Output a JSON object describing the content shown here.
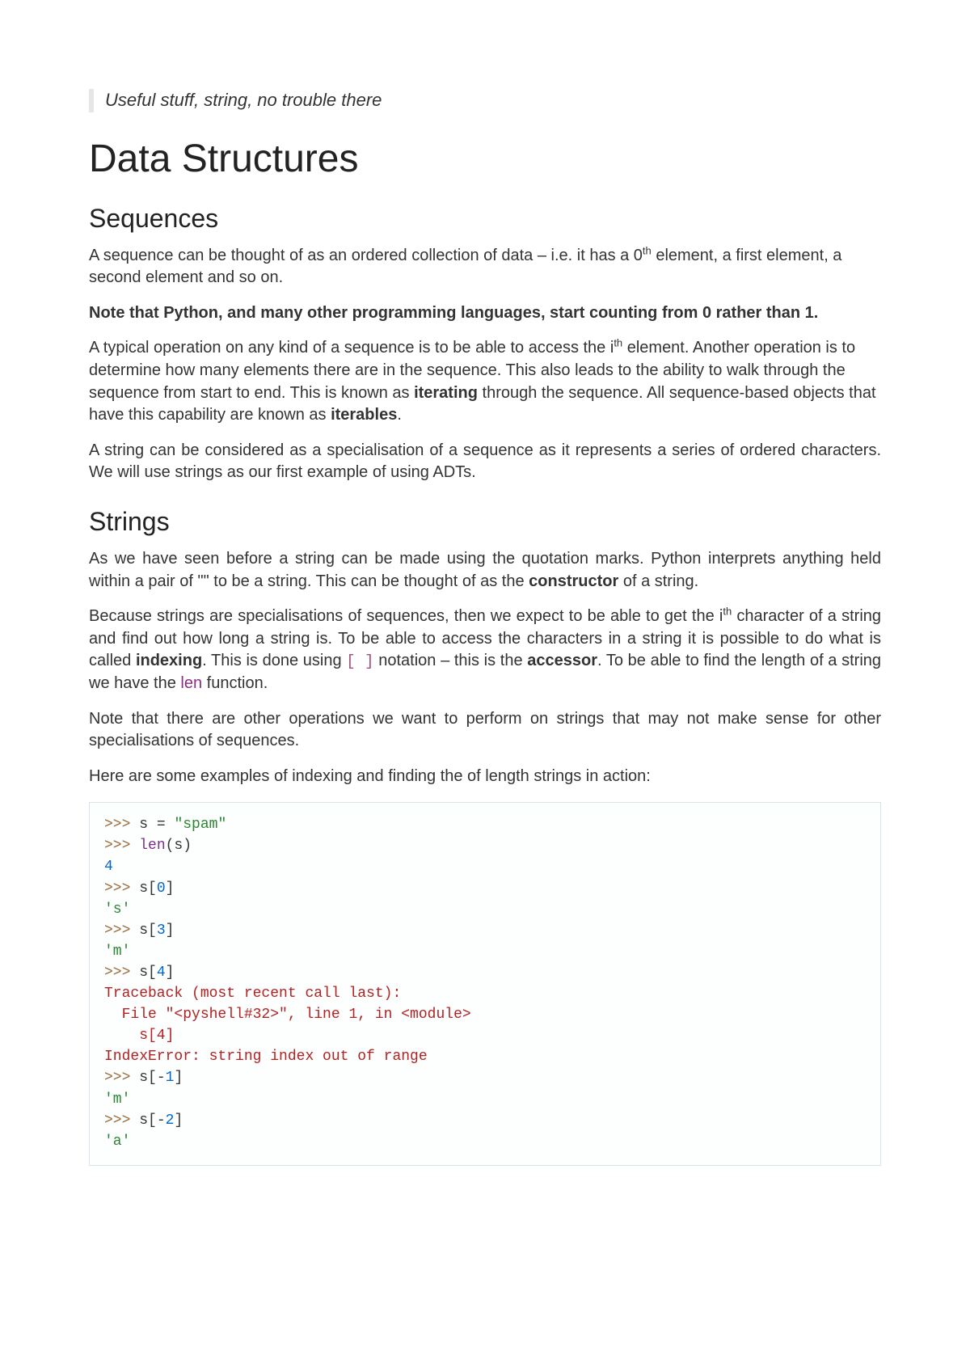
{
  "quote": "Useful stuff, string, no trouble there",
  "title": "Data Structures",
  "sequences": {
    "heading": "Sequences",
    "p1_a": "A sequence can be thought of as an ordered collection of data – i.e. it has a 0",
    "p1_sup": "th",
    "p1_b": " element, a first element, a second element and so on.",
    "note": "Note that Python, and many other programming languages, start counting from 0 rather than 1.",
    "p2_a": "A typical operation on any kind of a sequence is to be able to access the i",
    "p2_sup": "th",
    "p2_b": " element. Another operation is to determine how many elements there are in the sequence. This also leads to the ability to walk through the sequence from start to end. This is known as ",
    "p2_bold1": "iterating",
    "p2_c": " through the sequence. All sequence-based objects that have this capability are known as ",
    "p2_bold2": "iterables",
    "p2_d": ".",
    "p3": "A string can be considered as a specialisation of a sequence as it represents a series of ordered characters. We will use strings as our first example of using ADTs."
  },
  "strings": {
    "heading": "Strings",
    "p1_a": "As we have seen before a string can be made using the quotation marks. Python interprets anything held within a pair of \"\" to be a string. This can be thought of as the ",
    "p1_bold": "constructor",
    "p1_b": " of a string.",
    "p2_a": "Because strings are specialisations of sequences, then we expect to be able to get the i",
    "p2_sup": "th",
    "p2_b": " character of a string and find out how long a string is. To be able to access the characters in a string it is possible to do what is called ",
    "p2_bold1": "indexing",
    "p2_c": ". This is done using ",
    "p2_brackets": "[ ]",
    "p2_d": " notation – this is the ",
    "p2_bold2": "accessor",
    "p2_e": ". To be able to find the length of a string we have the ",
    "p2_len": "len",
    "p2_f": " function.",
    "p3": "Note that there are other operations we want to perform on strings that may not make sense for other specialisations of sequences.",
    "p4": "Here are some examples of indexing and finding the of length strings in action:"
  },
  "code": {
    "l1_prompt": ">>> ",
    "l1_rest": "s = ",
    "l1_str": "\"spam\"",
    "l2_prompt": ">>> ",
    "l2_fn": "len",
    "l2_rest": "(s)",
    "l3": "4",
    "l4_prompt": ">>> ",
    "l4_rest": "s[",
    "l4_num": "0",
    "l4_close": "]",
    "l5": "'s'",
    "l6_prompt": ">>> ",
    "l6_rest": "s[",
    "l6_num": "3",
    "l6_close": "]",
    "l7": "'m'",
    "l8_prompt": ">>> ",
    "l8_rest": "s[",
    "l8_num": "4",
    "l8_close": "]",
    "l9": "Traceback (most recent call last):",
    "l10": "  File \"<pyshell#32>\", line 1, in <module>",
    "l11": "    s[4]",
    "l12": "IndexError: string index out of range",
    "l13_prompt": ">>> ",
    "l13_rest": "s[-",
    "l13_num": "1",
    "l13_close": "]",
    "l14": "'m'",
    "l15_prompt": ">>> ",
    "l15_rest": "s[-",
    "l15_num": "2",
    "l15_close": "]",
    "l16": "'a'"
  }
}
